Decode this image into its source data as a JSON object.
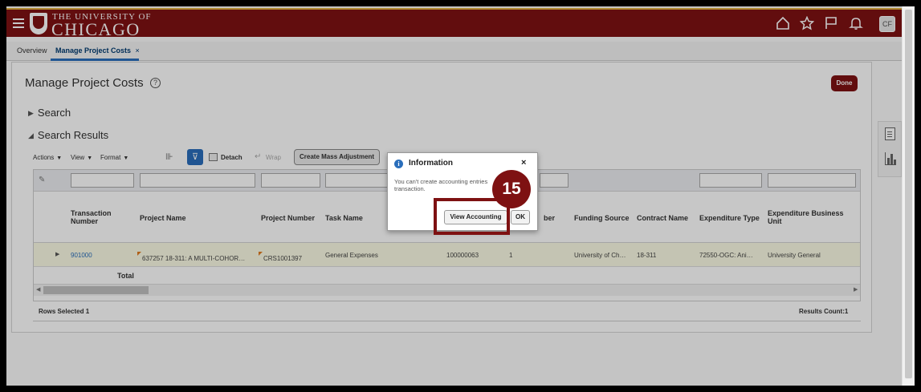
{
  "header": {
    "university_top": "THE UNIVERSITY OF",
    "university_main": "CHICAGO",
    "avatar_initials": "CF",
    "brand_color": "#7e1112"
  },
  "tabs": [
    {
      "label": "Overview"
    },
    {
      "label": "Manage Project Costs",
      "close": "×"
    }
  ],
  "page": {
    "title": "Manage Project Costs",
    "help": "?",
    "done_label": "Done"
  },
  "sections": {
    "search": "Search",
    "search_results": "Search Results"
  },
  "toolbar": {
    "actions": "Actions",
    "view": "View",
    "format": "Format",
    "detach": "Detach",
    "wrap": "Wrap",
    "mass_adjustment": "Create Mass Adjustment"
  },
  "table": {
    "columns": [
      "Transaction Number",
      "Project Name",
      "Project Number",
      "Task Name",
      "ber",
      "Funding Source",
      "Contract Name",
      "Expenditure Type",
      "Expenditure Business Unit",
      "E"
    ],
    "row": {
      "transaction_number": "901000",
      "project_name": "637257 18-311: A MULTI-COHOR…",
      "project_number": "CRS1001397",
      "task_name": "General Expenses",
      "col_a": "100000063",
      "col_b": "1",
      "funding_source": "University of Ch…",
      "contract_name": "18-311",
      "expenditure_type": "72550-OGC: Ani…",
      "business_unit": "University General",
      "col_last": ":"
    },
    "total_label": "Total",
    "rows_selected": "Rows Selected  1",
    "results_count": "Results Count:1"
  },
  "dialog": {
    "title": "Information",
    "message_line1": "You can't create accounting entries",
    "message_line2": "transaction.",
    "view_accounting_label": "View Accounting",
    "ok_label": "OK",
    "close": "×"
  },
  "annotation": {
    "step_number": "15"
  }
}
